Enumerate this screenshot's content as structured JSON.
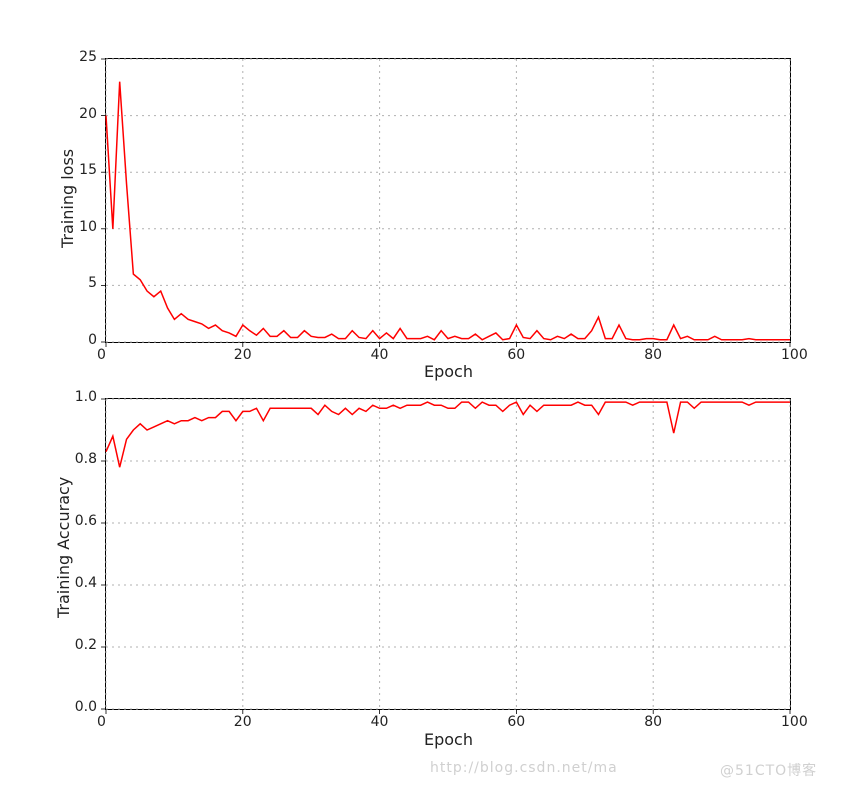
{
  "chart_data": [
    {
      "type": "line",
      "ylabel": "Training loss",
      "xlabel": "Epoch",
      "xlim": [
        0,
        100
      ],
      "ylim": [
        0,
        25
      ],
      "xticks": [
        0,
        20,
        40,
        60,
        80,
        100
      ],
      "yticks": [
        0,
        5,
        10,
        15,
        20,
        25
      ],
      "grid": true,
      "color": "#ff0000",
      "x": [
        0,
        1,
        2,
        3,
        4,
        5,
        6,
        7,
        8,
        9,
        10,
        11,
        12,
        13,
        14,
        15,
        16,
        17,
        18,
        19,
        20,
        21,
        22,
        23,
        24,
        25,
        26,
        27,
        28,
        29,
        30,
        31,
        32,
        33,
        34,
        35,
        36,
        37,
        38,
        39,
        40,
        41,
        42,
        43,
        44,
        45,
        46,
        47,
        48,
        49,
        50,
        51,
        52,
        53,
        54,
        55,
        56,
        57,
        58,
        59,
        60,
        61,
        62,
        63,
        64,
        65,
        66,
        67,
        68,
        69,
        70,
        71,
        72,
        73,
        74,
        75,
        76,
        77,
        78,
        79,
        80,
        81,
        82,
        83,
        84,
        85,
        86,
        87,
        88,
        89,
        90,
        91,
        92,
        93,
        94,
        95,
        96,
        97,
        98,
        99,
        100
      ],
      "values": [
        20.0,
        10.0,
        23.0,
        14.0,
        6.0,
        5.5,
        4.5,
        4.0,
        4.5,
        3.0,
        2.0,
        2.5,
        2.0,
        1.8,
        1.6,
        1.2,
        1.5,
        1.0,
        0.8,
        0.5,
        1.5,
        1.0,
        0.6,
        1.2,
        0.5,
        0.5,
        1.0,
        0.4,
        0.4,
        1.0,
        0.5,
        0.4,
        0.4,
        0.7,
        0.3,
        0.3,
        1.0,
        0.4,
        0.3,
        1.0,
        0.3,
        0.8,
        0.3,
        1.2,
        0.3,
        0.3,
        0.3,
        0.5,
        0.2,
        1.0,
        0.3,
        0.5,
        0.3,
        0.3,
        0.7,
        0.2,
        0.5,
        0.8,
        0.2,
        0.3,
        1.5,
        0.4,
        0.3,
        1.0,
        0.3,
        0.2,
        0.5,
        0.3,
        0.7,
        0.3,
        0.3,
        1.0,
        2.2,
        0.3,
        0.3,
        1.5,
        0.3,
        0.2,
        0.2,
        0.3,
        0.3,
        0.2,
        0.2,
        1.5,
        0.3,
        0.5,
        0.2,
        0.2,
        0.2,
        0.5,
        0.2,
        0.2,
        0.2,
        0.2,
        0.3,
        0.2,
        0.2,
        0.2,
        0.2,
        0.2,
        0.2
      ]
    },
    {
      "type": "line",
      "ylabel": "Training Accuracy",
      "xlabel": "Epoch",
      "xlim": [
        0,
        100
      ],
      "ylim": [
        0.0,
        1.0
      ],
      "xticks": [
        0,
        20,
        40,
        60,
        80,
        100
      ],
      "yticks": [
        0.0,
        0.2,
        0.4,
        0.6,
        0.8,
        1.0
      ],
      "grid": true,
      "color": "#ff0000",
      "x": [
        0,
        1,
        2,
        3,
        4,
        5,
        6,
        7,
        8,
        9,
        10,
        11,
        12,
        13,
        14,
        15,
        16,
        17,
        18,
        19,
        20,
        21,
        22,
        23,
        24,
        25,
        26,
        27,
        28,
        29,
        30,
        31,
        32,
        33,
        34,
        35,
        36,
        37,
        38,
        39,
        40,
        41,
        42,
        43,
        44,
        45,
        46,
        47,
        48,
        49,
        50,
        51,
        52,
        53,
        54,
        55,
        56,
        57,
        58,
        59,
        60,
        61,
        62,
        63,
        64,
        65,
        66,
        67,
        68,
        69,
        70,
        71,
        72,
        73,
        74,
        75,
        76,
        77,
        78,
        79,
        80,
        81,
        82,
        83,
        84,
        85,
        86,
        87,
        88,
        89,
        90,
        91,
        92,
        93,
        94,
        95,
        96,
        97,
        98,
        99,
        100
      ],
      "values": [
        0.83,
        0.88,
        0.78,
        0.87,
        0.9,
        0.92,
        0.9,
        0.91,
        0.92,
        0.93,
        0.92,
        0.93,
        0.93,
        0.94,
        0.93,
        0.94,
        0.94,
        0.96,
        0.96,
        0.93,
        0.96,
        0.96,
        0.97,
        0.93,
        0.97,
        0.97,
        0.97,
        0.97,
        0.97,
        0.97,
        0.97,
        0.95,
        0.98,
        0.96,
        0.95,
        0.97,
        0.95,
        0.97,
        0.96,
        0.98,
        0.97,
        0.97,
        0.98,
        0.97,
        0.98,
        0.98,
        0.98,
        0.99,
        0.98,
        0.98,
        0.97,
        0.97,
        0.99,
        0.99,
        0.97,
        0.99,
        0.98,
        0.98,
        0.96,
        0.98,
        0.99,
        0.95,
        0.98,
        0.96,
        0.98,
        0.98,
        0.98,
        0.98,
        0.98,
        0.99,
        0.98,
        0.98,
        0.95,
        0.99,
        0.99,
        0.99,
        0.99,
        0.98,
        0.99,
        0.99,
        0.99,
        0.99,
        0.99,
        0.89,
        0.99,
        0.99,
        0.97,
        0.99,
        0.99,
        0.99,
        0.99,
        0.99,
        0.99,
        0.99,
        0.98,
        0.99,
        0.99,
        0.99,
        0.99,
        0.99,
        0.99
      ]
    }
  ],
  "watermark_left": "http://blog.csdn.net/ma",
  "watermark_right": "@51CTO博客"
}
